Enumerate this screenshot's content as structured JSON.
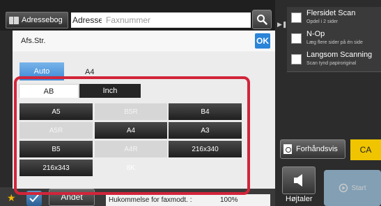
{
  "header": {
    "address_book_label": "Adressebog",
    "address_label": "Adresse",
    "fax_placeholder": "Faxnummer"
  },
  "options": [
    {
      "title": "Flersidet Scan",
      "subtitle": "Opdel i 2 sider"
    },
    {
      "title": "N-Op",
      "subtitle": "Læg flere sider på én side"
    },
    {
      "title": "Langsom Scanning",
      "subtitle": "Scan tynd papiroriginal"
    }
  ],
  "dialog": {
    "title": "Afs.Str.",
    "ok_label": "OK",
    "auto_label": "Auto",
    "auto_value": "A4",
    "tabs": [
      {
        "label": "AB",
        "selected": true
      },
      {
        "label": "Inch",
        "selected": false
      }
    ],
    "sizes": [
      {
        "label": "A5",
        "enabled": true
      },
      {
        "label": "B5R",
        "enabled": false
      },
      {
        "label": "B4",
        "enabled": true
      },
      {
        "label": "A5R",
        "enabled": false
      },
      {
        "label": "A4",
        "enabled": true
      },
      {
        "label": "A3",
        "enabled": true
      },
      {
        "label": "B5",
        "enabled": true
      },
      {
        "label": "A4R",
        "enabled": false
      },
      {
        "label": "216x340",
        "enabled": true
      },
      {
        "label": "216x343",
        "enabled": true
      },
      {
        "label": "8K",
        "enabled": false
      }
    ]
  },
  "actions": {
    "preview_label": "Forhåndsvis",
    "ca_label": "CA",
    "speaker_label": "Højtaler",
    "start_label": "Start"
  },
  "bottom": {
    "other_label": "Andet",
    "memory_label": "Hukommelse for faxmodt. :",
    "memory_value": "100%"
  },
  "colors": {
    "accent_blue": "#3d88d4",
    "highlight_red": "#d2253a",
    "ca_yellow": "#f0c500"
  }
}
